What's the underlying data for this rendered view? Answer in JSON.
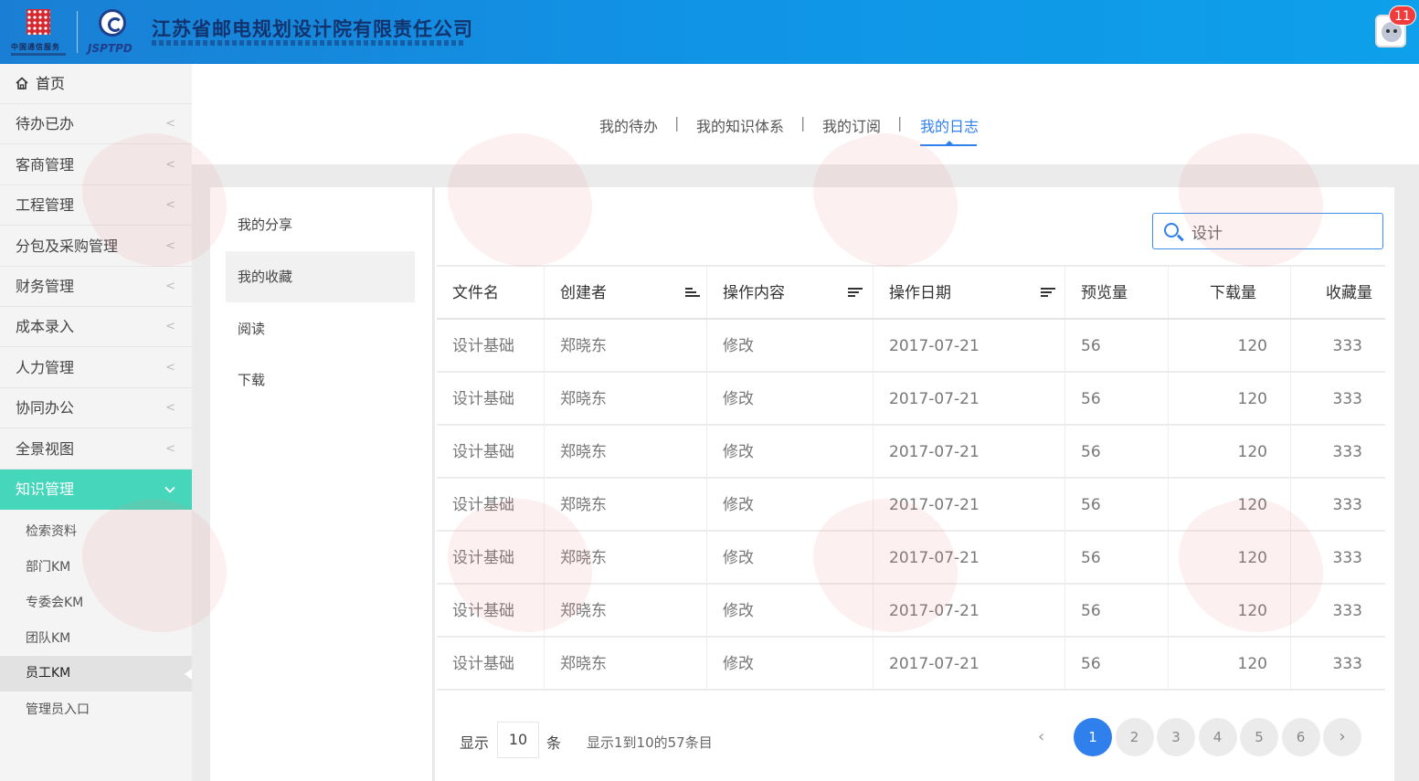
{
  "header": {
    "logo1_caption": "中国通信服务",
    "logo2_caption": "JSPTPD",
    "company_name": "江苏省邮电规划设计院有限责任公司",
    "notification_count": "11"
  },
  "sidebar": {
    "home": "首页",
    "items": [
      {
        "label": "待办已办"
      },
      {
        "label": "客商管理"
      },
      {
        "label": "工程管理"
      },
      {
        "label": "分包及采购管理"
      },
      {
        "label": "财务管理"
      },
      {
        "label": "成本录入"
      },
      {
        "label": "人力管理"
      },
      {
        "label": "协同办公"
      },
      {
        "label": "全景视图"
      },
      {
        "label": "知识管理"
      }
    ],
    "sub_items": [
      {
        "label": "检索资料"
      },
      {
        "label": "部门KM"
      },
      {
        "label": "专委会KM"
      },
      {
        "label": "团队KM"
      },
      {
        "label": "员工KM"
      },
      {
        "label": "管理员入口"
      }
    ]
  },
  "tabs": [
    {
      "label": "我的待办"
    },
    {
      "label": "我的知识体系"
    },
    {
      "label": "我的订阅"
    },
    {
      "label": "我的日志"
    }
  ],
  "tab_separator": "|",
  "subnav": [
    {
      "label": "我的分享"
    },
    {
      "label": "我的收藏"
    },
    {
      "label": "阅读"
    },
    {
      "label": "下载"
    }
  ],
  "search": {
    "value": "设计"
  },
  "table": {
    "headers": [
      "文件名",
      "创建者",
      "操作内容",
      "操作日期",
      "预览量",
      "下载量",
      "收藏量"
    ],
    "rows": [
      [
        "设计基础",
        "郑晓东",
        "修改",
        "2017-07-21",
        "56",
        "120",
        "333"
      ],
      [
        "设计基础",
        "郑晓东",
        "修改",
        "2017-07-21",
        "56",
        "120",
        "333"
      ],
      [
        "设计基础",
        "郑晓东",
        "修改",
        "2017-07-21",
        "56",
        "120",
        "333"
      ],
      [
        "设计基础",
        "郑晓东",
        "修改",
        "2017-07-21",
        "56",
        "120",
        "333"
      ],
      [
        "设计基础",
        "郑晓东",
        "修改",
        "2017-07-21",
        "56",
        "120",
        "333"
      ],
      [
        "设计基础",
        "郑晓东",
        "修改",
        "2017-07-21",
        "56",
        "120",
        "333"
      ],
      [
        "设计基础",
        "郑晓东",
        "修改",
        "2017-07-21",
        "56",
        "120",
        "333"
      ]
    ]
  },
  "pagination": {
    "show_label": "显示",
    "page_size": "10",
    "unit_label": "条",
    "info": "显示1到10的57条目",
    "pages": [
      "1",
      "2",
      "3",
      "4",
      "5",
      "6"
    ],
    "prev": "‹",
    "next": "›"
  },
  "colors": {
    "accent": "#2f80ed",
    "menu_active": "#45d6bb",
    "header_blue": "#1094e6",
    "badge": "#f03c3c"
  }
}
